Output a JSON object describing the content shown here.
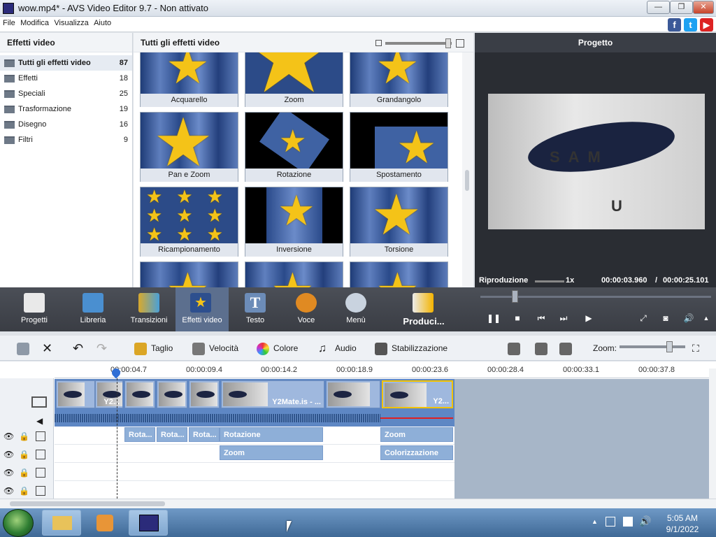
{
  "window": {
    "title": "wow.mp4* - AVS Video Editor 9.7 - Non attivato",
    "minimize": "—",
    "maximize": "❐",
    "close": "✕"
  },
  "menu": [
    "File",
    "Modifica",
    "Visualizza",
    "Aiuto"
  ],
  "social": {
    "facebook": "f",
    "twitter": "t",
    "youtube": "▶"
  },
  "left_panel": {
    "title": "Effetti video",
    "categories": [
      {
        "name": "Tutti gli effetti video",
        "count": "87"
      },
      {
        "name": "Effetti",
        "count": "18"
      },
      {
        "name": "Speciali",
        "count": "25"
      },
      {
        "name": "Trasformazione",
        "count": "19"
      },
      {
        "name": "Disegno",
        "count": "16"
      },
      {
        "name": "Filtri",
        "count": "9"
      }
    ]
  },
  "gallery": {
    "title": "Tutti gli effetti video",
    "tiles": [
      "Acquarello",
      "Zoom",
      "Grandangolo",
      "Pan e Zoom",
      "Rotazione",
      "Spostamento",
      "Ricampionamento",
      "Inversione",
      "Torsione",
      "",
      "",
      ""
    ]
  },
  "preview": {
    "title": "Progetto",
    "status": "Riproduzione",
    "speed": "1x",
    "time_current": "00:00:03.960",
    "time_separator": "/",
    "time_total": "00:00:25.101",
    "overlay_text": "SAM",
    "overlay_u": "U"
  },
  "toolbar": [
    "Progetti",
    "Libreria",
    "Transizioni",
    "Effetti video",
    "Testo",
    "Voce",
    "Menù",
    "Produci..."
  ],
  "edit_toolbar": {
    "cut": "Taglio",
    "speed": "Velocità",
    "color": "Colore",
    "audio": "Audio",
    "stabilize": "Stabilizzazione",
    "zoom": "Zoom:"
  },
  "timeline": {
    "ticks": [
      "00:00:04.7",
      "00:00:09.4",
      "00:00:14.2",
      "00:00:18.9",
      "00:00:23.6",
      "00:00:28.4",
      "00:00:33.1",
      "00:00:37.8"
    ],
    "clips": [
      "",
      "Y2...",
      "",
      "",
      "",
      "Y2Mate.is - ...",
      "",
      "Y2..."
    ],
    "fx_row1": [
      "Rota...",
      "Rota...",
      "Rota...",
      "Rotazione",
      "Zoom"
    ],
    "fx_row2": [
      "Zoom",
      "Colorizzazione"
    ]
  },
  "taskbar": {
    "time": "5:05 AM",
    "date": "9/1/2022"
  }
}
